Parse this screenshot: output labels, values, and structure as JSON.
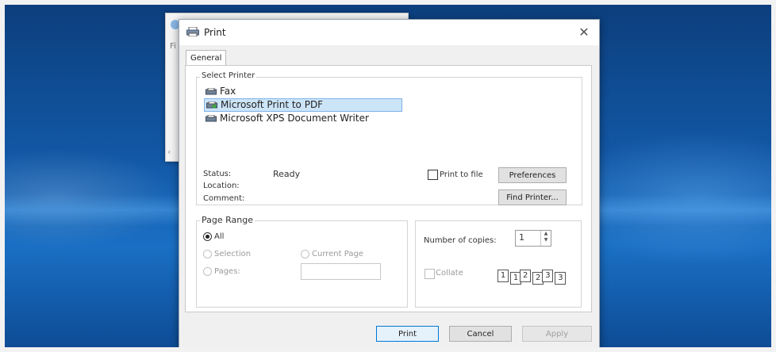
{
  "background_window": {
    "text": "Fi"
  },
  "dialog": {
    "title": "Print",
    "close_glyph": "✕",
    "tabs": [
      {
        "label": "General"
      }
    ],
    "select_printer": {
      "group_title": "Select Printer",
      "printers": [
        {
          "name": "Fax",
          "icon": "fax-printer-icon",
          "selected": false
        },
        {
          "name": "Microsoft Print to PDF",
          "icon": "pdf-printer-icon",
          "selected": true
        },
        {
          "name": "Microsoft XPS Document Writer",
          "icon": "xps-printer-icon",
          "selected": false
        }
      ],
      "status_label": "Status:",
      "status_value": "Ready",
      "location_label": "Location:",
      "comment_label": "Comment:",
      "print_to_file_label": "Print to file",
      "preferences_label": "Preferences",
      "find_printer_label": "Find Printer..."
    },
    "page_range": {
      "group_title": "Page Range",
      "all_label": "All",
      "selection_label": "Selection",
      "current_page_label": "Current Page",
      "pages_label": "Pages:",
      "pages_value": ""
    },
    "copies": {
      "number_label": "Number of copies:",
      "number_value": "1",
      "collate_label": "Collate",
      "collate_pages": [
        "1",
        "1",
        "2",
        "2",
        "3",
        "3"
      ]
    },
    "buttons": {
      "print": "Print",
      "cancel": "Cancel",
      "apply": "Apply"
    }
  }
}
